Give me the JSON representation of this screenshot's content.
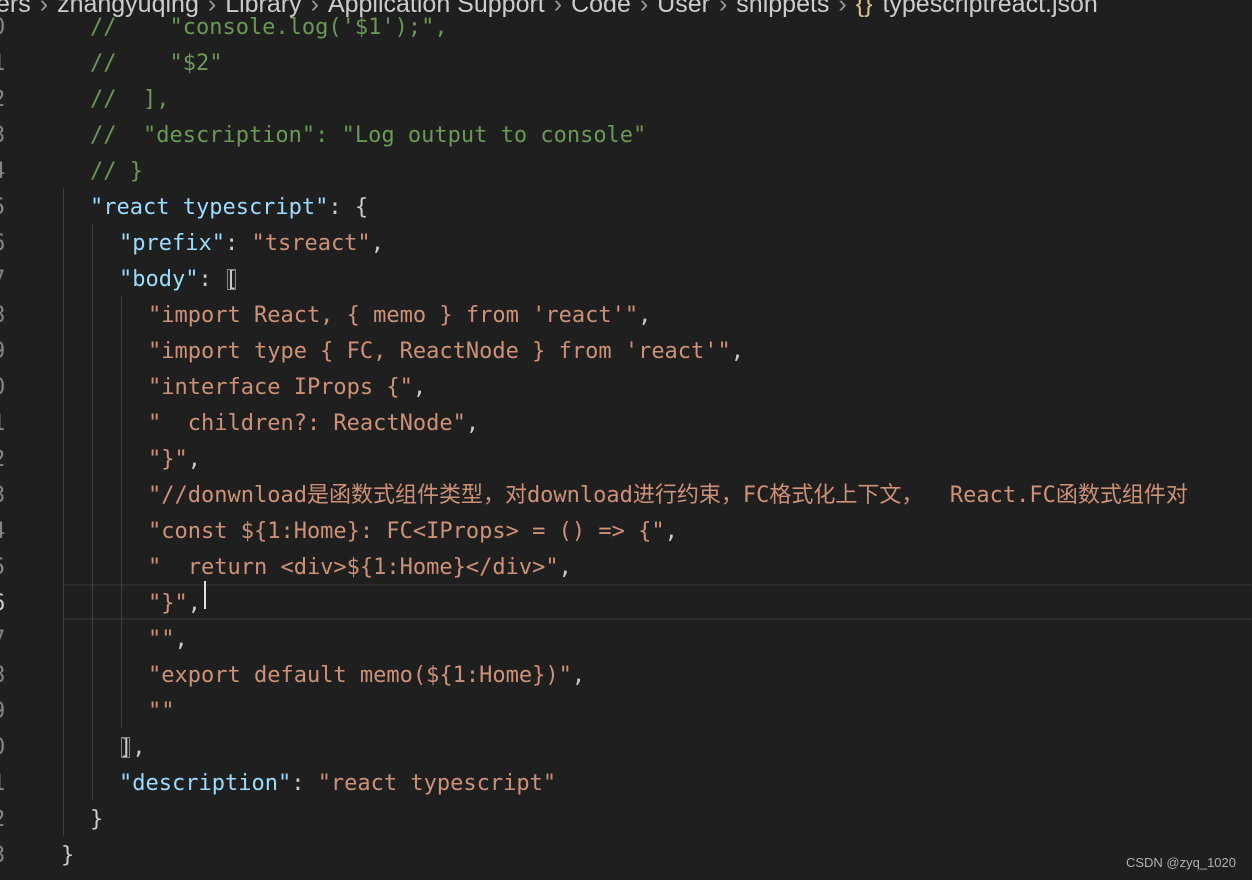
{
  "breadcrumb": {
    "items": [
      "ers",
      "zhangyuqing",
      "Library",
      "Application Support",
      "Code",
      "User",
      "snippets"
    ],
    "file_icon": "{}",
    "file_name": "typescriptreact.json"
  },
  "lines": [
    {
      "n": "0",
      "t": "//    \"console.log('$1');\","
    },
    {
      "n": "1",
      "t": "//    \"$2\""
    },
    {
      "n": "2",
      "t": "//  ],"
    },
    {
      "n": "3",
      "t": "//  \"description\": \"Log output to console\""
    },
    {
      "n": "4",
      "t": "// }"
    },
    {
      "n": "5",
      "k": "\"react typescript\"",
      "p": ": {"
    },
    {
      "n": "6",
      "k": "\"prefix\"",
      "p": ": ",
      "s": "\"tsreact\"",
      "e": ","
    },
    {
      "n": "7",
      "k": "\"body\"",
      "p": ": ",
      "b": "["
    },
    {
      "n": "8",
      "s": "\"import React, { memo } from 'react'\"",
      "e": ","
    },
    {
      "n": "9",
      "s": "\"import type { FC, ReactNode } from 'react'\"",
      "e": ","
    },
    {
      "n": "0",
      "s": "\"interface IProps {\"",
      "e": ","
    },
    {
      "n": "1",
      "s": "\"  children?: ReactNode\"",
      "e": ","
    },
    {
      "n": "2",
      "s": "\"}\"",
      "e": ","
    },
    {
      "n": "3",
      "s": "\"//donwnload是函数式组件类型，对download进行约束，FC格式化上下文，  React.FC函数式组件对"
    },
    {
      "n": "4",
      "s": "\"const ${1:Home}: FC<IProps> = () => {\"",
      "e": ","
    },
    {
      "n": "5",
      "s": "\"  return <div>${1:Home}</div>\"",
      "e": ","
    },
    {
      "n": "6",
      "s": "\"}\"",
      "e": ","
    },
    {
      "n": "7",
      "s": "\"\"",
      "e": ","
    },
    {
      "n": "8",
      "s": "\"export default memo(${1:Home})\"",
      "e": ","
    },
    {
      "n": "9",
      "s": "\"\""
    },
    {
      "n": "0",
      "b": "]",
      "e": ","
    },
    {
      "n": "1",
      "k": "\"description\"",
      "p": ": ",
      "s": "\"react typescript\""
    },
    {
      "n": "2",
      "p": "}"
    },
    {
      "n": "3",
      "p": "}"
    }
  ],
  "watermark": "CSDN @zyq_1020"
}
